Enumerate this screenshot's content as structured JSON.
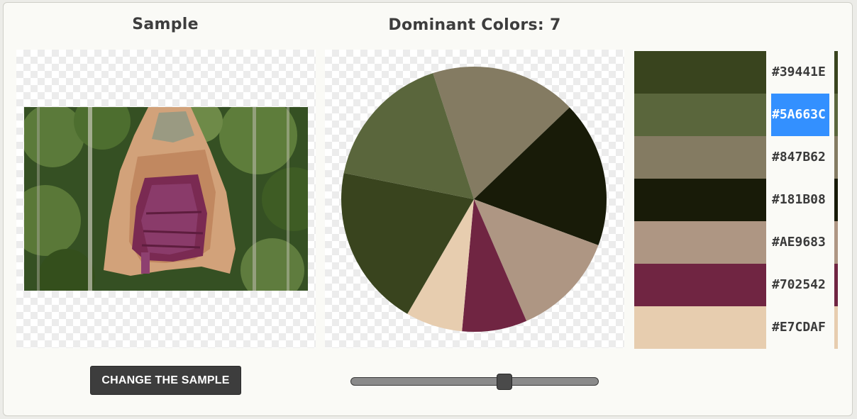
{
  "headings": {
    "sample": "Sample",
    "dominant": "Dominant Colors: 7"
  },
  "button": {
    "change_sample": "CHANGE THE SAMPLE"
  },
  "slider": {
    "value_fraction": 0.62
  },
  "colors": [
    {
      "hex": "#39441E",
      "label": "#39441E",
      "selected": false
    },
    {
      "hex": "#5A663C",
      "label": "#5A663C",
      "selected": true
    },
    {
      "hex": "#847B62",
      "label": "#847B62",
      "selected": false
    },
    {
      "hex": "#181B08",
      "label": "#181B08",
      "selected": false
    },
    {
      "hex": "#AE9683",
      "label": "#AE9683",
      "selected": false
    },
    {
      "hex": "#702542",
      "label": "#702542",
      "selected": false
    },
    {
      "hex": "#E7CDAF",
      "label": "#E7CDAF",
      "selected": false
    }
  ],
  "chart_data": {
    "type": "pie",
    "slices": [
      {
        "color": "#847B62",
        "value": 18
      },
      {
        "color": "#181B08",
        "value": 18
      },
      {
        "color": "#AE9683",
        "value": 13
      },
      {
        "color": "#702542",
        "value": 8
      },
      {
        "color": "#E7CDAF",
        "value": 7
      },
      {
        "color": "#39441E",
        "value": 20
      },
      {
        "color": "#5A663C",
        "value": 17
      }
    ]
  }
}
